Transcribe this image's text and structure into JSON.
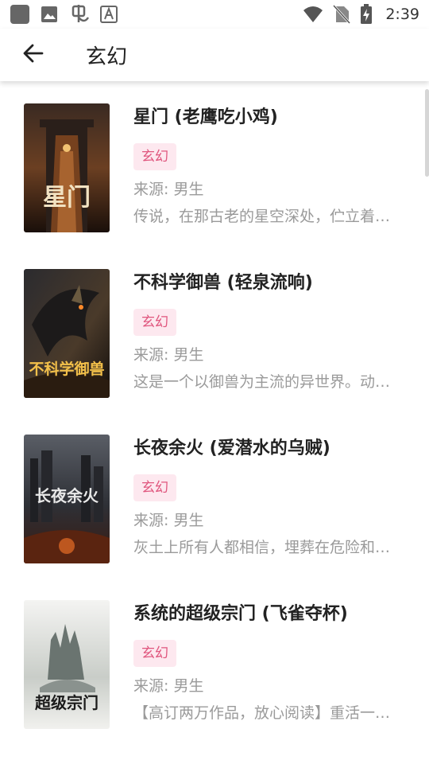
{
  "status_bar": {
    "time": "2:39",
    "left_icons": [
      "app-square-icon",
      "image-icon",
      "bug-app-icon",
      "font-a-icon"
    ],
    "right_icons": [
      "wifi-icon",
      "no-sim-icon",
      "battery-charging-icon"
    ]
  },
  "app_bar": {
    "title": "玄幻",
    "back_icon": "arrow-left-icon"
  },
  "books": [
    {
      "title": "星门 (老鹰吃小鸡)",
      "tag": "玄幻",
      "source": "来源: 男生",
      "description": "传说，在那古老的星空深处，伫立着一道血与火侵染的红色之门",
      "cover_text": "星门"
    },
    {
      "title": "不科学御兽 (轻泉流响)",
      "tag": "玄幻",
      "source": "来源: 男生",
      "description": "这是一个以御兽为主流的异世界。动物、植物、妖魔、精灵",
      "cover_text": "不科学御兽"
    },
    {
      "title": "长夜余火 (爱潜水的乌贼)",
      "tag": "玄幻",
      "source": "来源: 男生",
      "description": "灰土上所有人都相信，埋葬在危险和绝望中的古老城市",
      "cover_text": "长夜余火"
    },
    {
      "title": "系统的超级宗门 (飞雀夺杯)",
      "tag": "玄幻",
      "source": "来源: 男生",
      "description": "【高订两万作品，放心阅读】重活一世，获得系统",
      "cover_text": "超级宗门"
    }
  ],
  "colors": {
    "tag_bg": "#fde8ef",
    "tag_text": "#e0567e",
    "muted_text": "#9a9a9a"
  }
}
